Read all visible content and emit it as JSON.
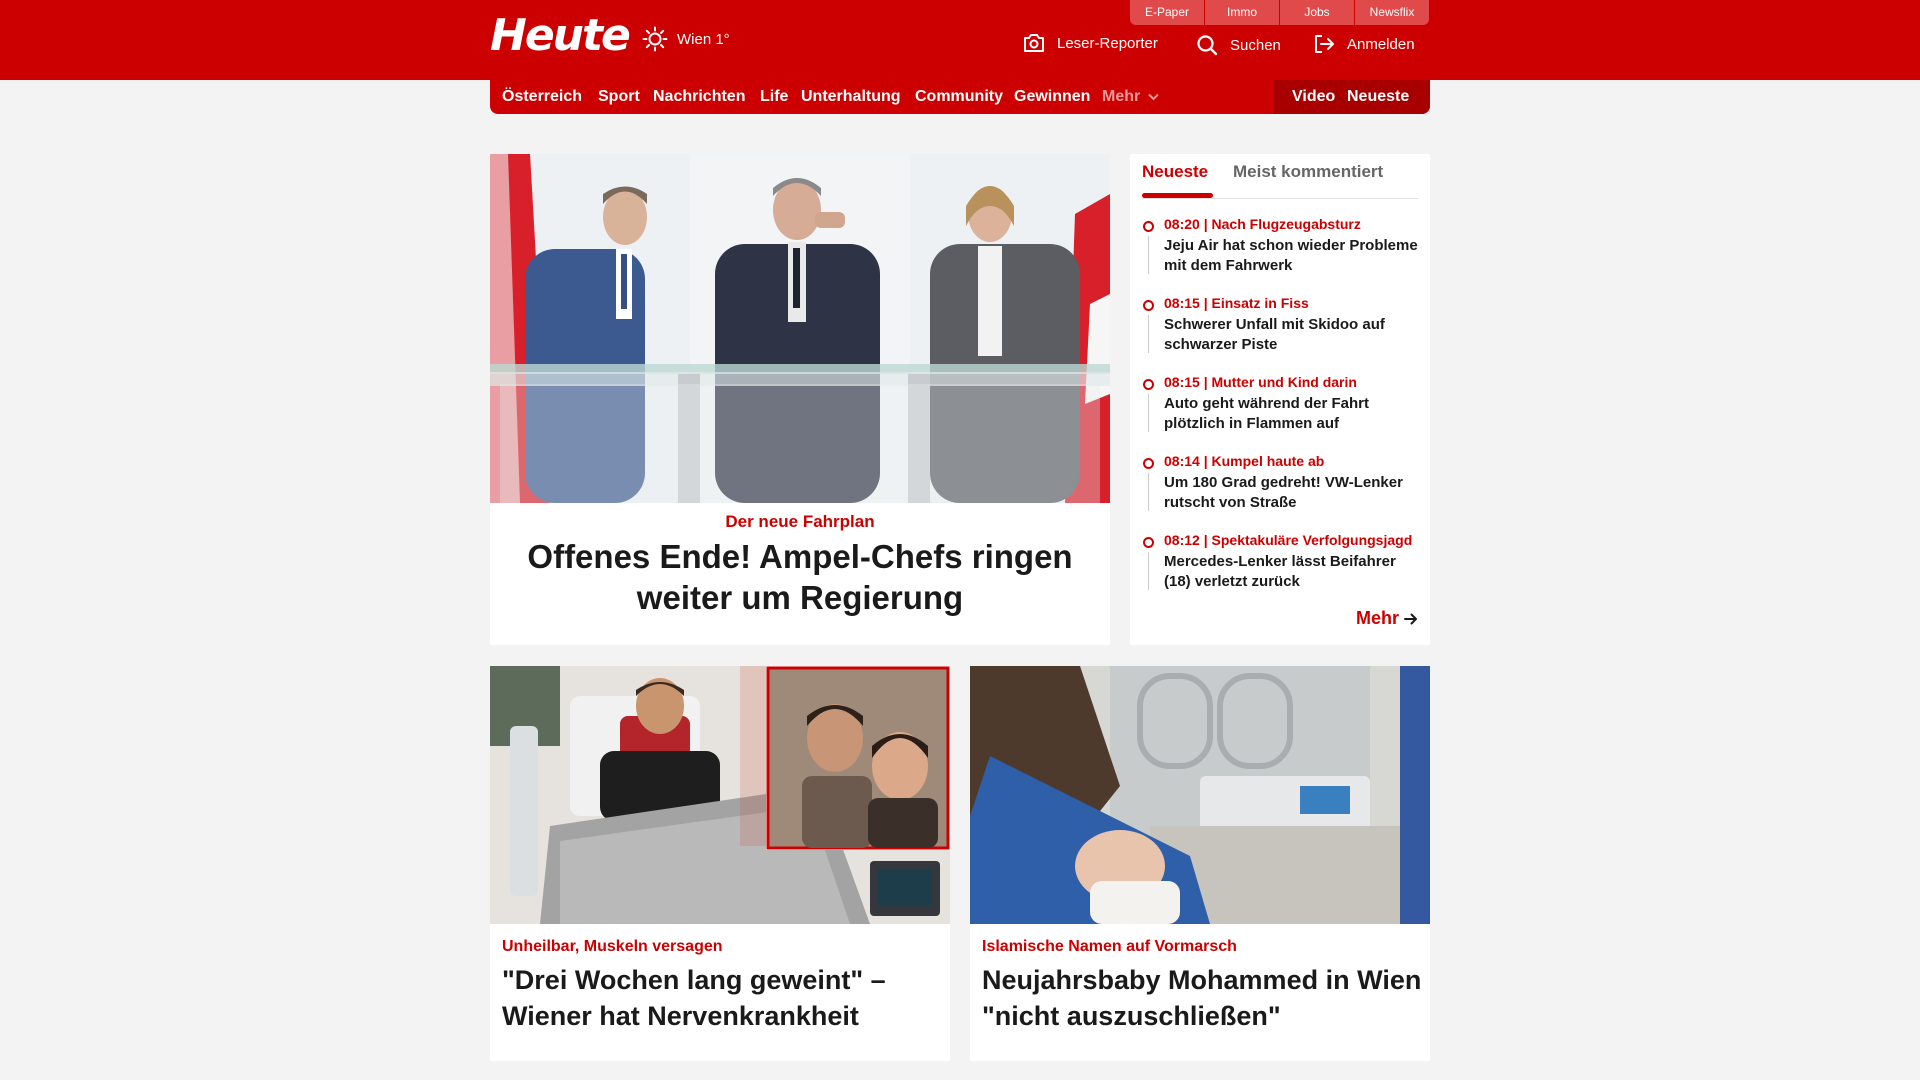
{
  "brand": {
    "logo": "Heute",
    "weather": "Wien 1°"
  },
  "toplinks": [
    "E-Paper",
    "Immo",
    "Jobs",
    "Newsflix"
  ],
  "actions": {
    "reporter": "Leser-Reporter",
    "search": "Suchen",
    "login": "Anmelden"
  },
  "nav": {
    "items": [
      "Österreich",
      "Sport",
      "Nachrichten",
      "Life",
      "Unterhaltung",
      "Community",
      "Gewinnen"
    ],
    "more": "Mehr",
    "video": "Video",
    "latest": "Neueste"
  },
  "hero": {
    "kicker": "Der neue Fahrplan",
    "title": "Offenes Ende! Ampel-Chefs ringen weiter um Regierung"
  },
  "sidebar": {
    "tabs": [
      "Neueste",
      "Meist kommentiert"
    ],
    "items": [
      {
        "time": "08:20",
        "topic": "Nach Flugzeugabsturz",
        "title": "Jeju Air hat schon wieder Probleme mit dem Fahrwerk"
      },
      {
        "time": "08:15",
        "topic": "Einsatz in Fiss",
        "title": "Schwerer Unfall mit Skidoo auf schwarzer Piste"
      },
      {
        "time": "08:15",
        "topic": "Mutter und Kind darin",
        "title": "Auto geht während der Fahrt plötzlich in Flammen auf"
      },
      {
        "time": "08:14",
        "topic": "Kumpel haute ab",
        "title": "Um 180 Grad gedreht! VW-Lenker rutscht von Straße"
      },
      {
        "time": "08:12",
        "topic": "Spektakuläre Verfolgungsjagd",
        "title": "Mercedes-Lenker lässt Beifahrer (18) verletzt zurück"
      }
    ],
    "more": "Mehr"
  },
  "cards": [
    {
      "kicker": "Unheilbar, Muskeln versagen",
      "title": "\"Drei Wochen lang geweint\" – Wiener hat Nervenkrankheit"
    },
    {
      "kicker": "Islamische Namen auf Vormarsch",
      "title": "Neujahrsbaby Mohammed in Wien \"nicht auszuschließen\""
    }
  ],
  "colors": {
    "brand_red": "#cc0000",
    "nav_dark_red": "#a80000",
    "background": "#f3f3f3"
  },
  "icons": [
    "sun-icon",
    "camera-icon",
    "search-icon",
    "login-icon",
    "chevron-down-icon",
    "arrow-right-icon"
  ]
}
